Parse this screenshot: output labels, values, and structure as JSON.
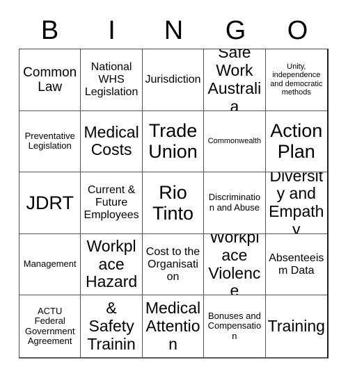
{
  "card": {
    "title": "BINGO",
    "header": {
      "letters": [
        "B",
        "I",
        "N",
        "G",
        "O"
      ]
    },
    "colors": {
      "text": "#000000",
      "grid_line": "#555555",
      "background": "#ffffff"
    },
    "grid": {
      "columns": 5,
      "rows": 5,
      "cells": [
        {
          "label": "Common Law",
          "size": "l"
        },
        {
          "label": "National WHS Legislation",
          "size": "m"
        },
        {
          "label": "Jurisdiction",
          "size": "m"
        },
        {
          "label": "Safe Work Australia",
          "size": "xl"
        },
        {
          "label": "Unity, independence and democratic methods",
          "size": "xs"
        },
        {
          "label": "Preventative Legislation",
          "size": "s"
        },
        {
          "label": "Medical Costs",
          "size": "xl"
        },
        {
          "label": "Trade Union",
          "size": "xxl"
        },
        {
          "label": "Commonwealth",
          "size": "xs"
        },
        {
          "label": "Action Plan",
          "size": "xxl"
        },
        {
          "label": "JDRT",
          "size": "xxl"
        },
        {
          "label": "Current & Future Employees",
          "size": "m"
        },
        {
          "label": "Rio Tinto",
          "size": "xxl"
        },
        {
          "label": "Discrimination and Abuse",
          "size": "s"
        },
        {
          "label": "Diversity and Empathy",
          "size": "xl"
        },
        {
          "label": "Management",
          "size": "s"
        },
        {
          "label": "Workplace Hazard",
          "size": "xl"
        },
        {
          "label": "Cost to the Organisation",
          "size": "m"
        },
        {
          "label": "Workplace Violence",
          "size": "xl"
        },
        {
          "label": "Absenteeism Data",
          "size": "m"
        },
        {
          "label": "ACTU Federal Government Agreement",
          "size": "s"
        },
        {
          "label": "Health & Safety Training",
          "size": "xl"
        },
        {
          "label": "Medical Attention",
          "size": "xl"
        },
        {
          "label": "Bonuses and Compensation",
          "size": "s"
        },
        {
          "label": "Training",
          "size": "xl"
        }
      ]
    }
  }
}
